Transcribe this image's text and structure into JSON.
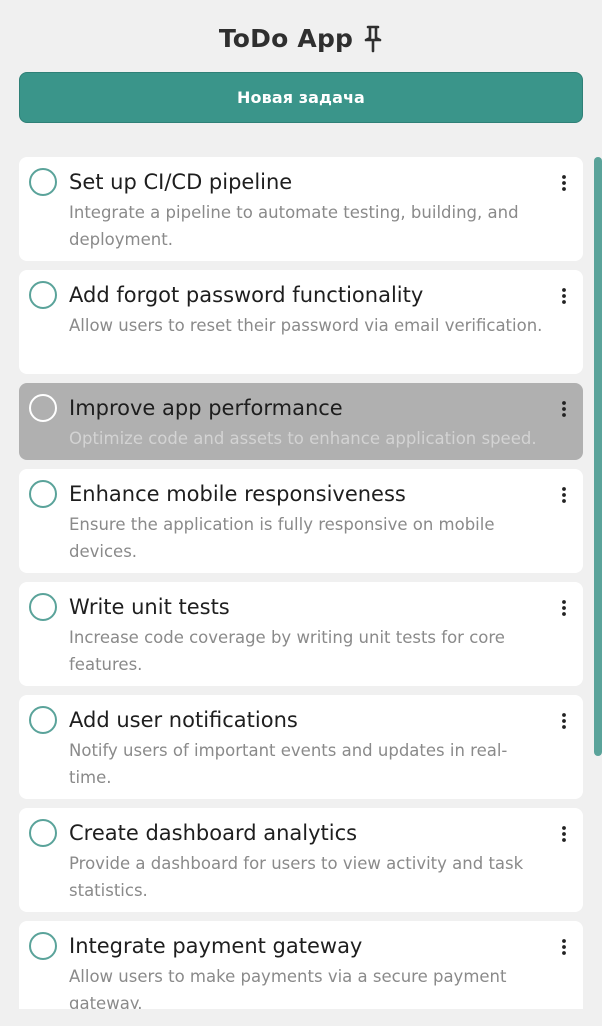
{
  "header": {
    "title": "ToDo App",
    "icon": "pin-icon"
  },
  "new_task_button": {
    "label": "Новая задача"
  },
  "colors": {
    "accent": "#3a958a",
    "circle": "#5aa39a",
    "background": "#f0f0f0",
    "highlight_row": "#b0b0b0"
  },
  "tasks": [
    {
      "title": "Set up CI/CD pipeline",
      "description": "Integrate a pipeline to automate testing, building, and deployment.",
      "highlighted": false
    },
    {
      "title": "Add forgot password functionality",
      "description": "Allow users to reset their password via email verification.",
      "highlighted": false
    },
    {
      "title": "Improve app performance",
      "description": "Optimize code and assets to enhance application speed.",
      "highlighted": true
    },
    {
      "title": "Enhance mobile responsiveness",
      "description": "Ensure the application is fully responsive on mobile devices.",
      "highlighted": false
    },
    {
      "title": "Write unit tests",
      "description": "Increase code coverage by writing unit tests for core features.",
      "highlighted": false
    },
    {
      "title": "Add user notifications",
      "description": "Notify users of important events and updates in real-time.",
      "highlighted": false
    },
    {
      "title": "Create dashboard analytics",
      "description": "Provide a dashboard for users to view activity and task statistics.",
      "highlighted": false
    },
    {
      "title": "Integrate payment gateway",
      "description": "Allow users to make payments via a secure payment gateway.",
      "highlighted": false
    }
  ]
}
